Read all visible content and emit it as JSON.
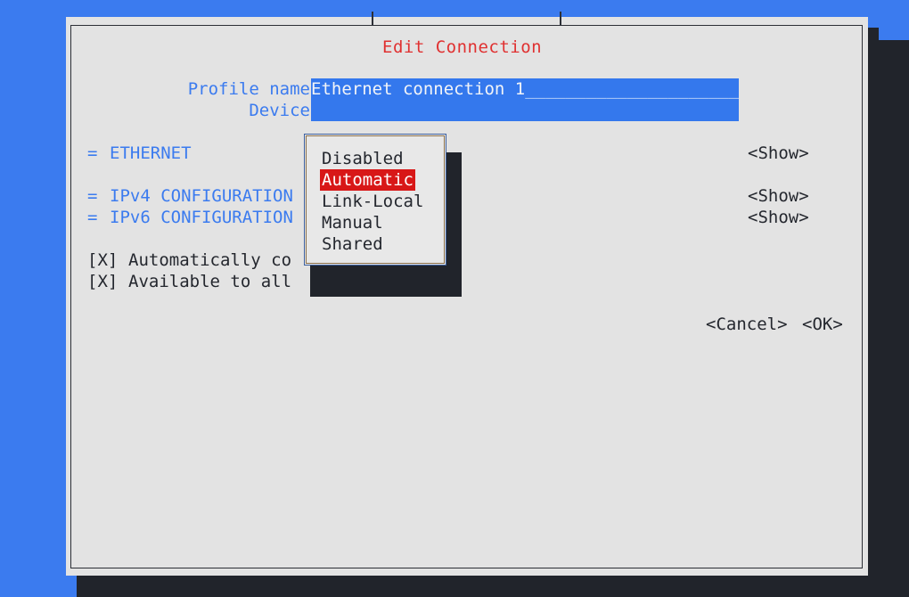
{
  "window": {
    "title": "Edit Connection",
    "title_color": "#e03131",
    "background": "#e3e3e3",
    "desktop_color": "#3b7bef",
    "shadow_color": "#21242b"
  },
  "form": {
    "fields": [
      {
        "label": "Profile name",
        "value": "Ethernet connection 1",
        "fill": "_______________________"
      },
      {
        "label": "Device",
        "value": "",
        "fill": ""
      }
    ],
    "sections": [
      {
        "marker": "=",
        "label": "ETHERNET",
        "action": "<Show>"
      },
      {
        "marker": "=",
        "label": "IPv4 CONFIGURATION",
        "action": "<Show>"
      },
      {
        "marker": "=",
        "label": "IPv6 CONFIGURATION",
        "action": "<Show>"
      }
    ],
    "checkboxes": [
      {
        "mark": "[X]",
        "label": "Automatically co"
      },
      {
        "mark": "[X]",
        "label": "Available to all"
      }
    ],
    "buttons": {
      "cancel": "<Cancel>",
      "ok": "<OK>"
    }
  },
  "popup": {
    "name": "ipv4-configuration-dropdown",
    "selected": "Automatic",
    "highlight_color": "#d81717",
    "items": [
      {
        "label": "Disabled",
        "selected": false
      },
      {
        "label": "Automatic",
        "selected": true
      },
      {
        "label": "Link-Local",
        "selected": false
      },
      {
        "label": "Manual",
        "selected": false
      },
      {
        "label": "Shared",
        "selected": false
      }
    ]
  }
}
